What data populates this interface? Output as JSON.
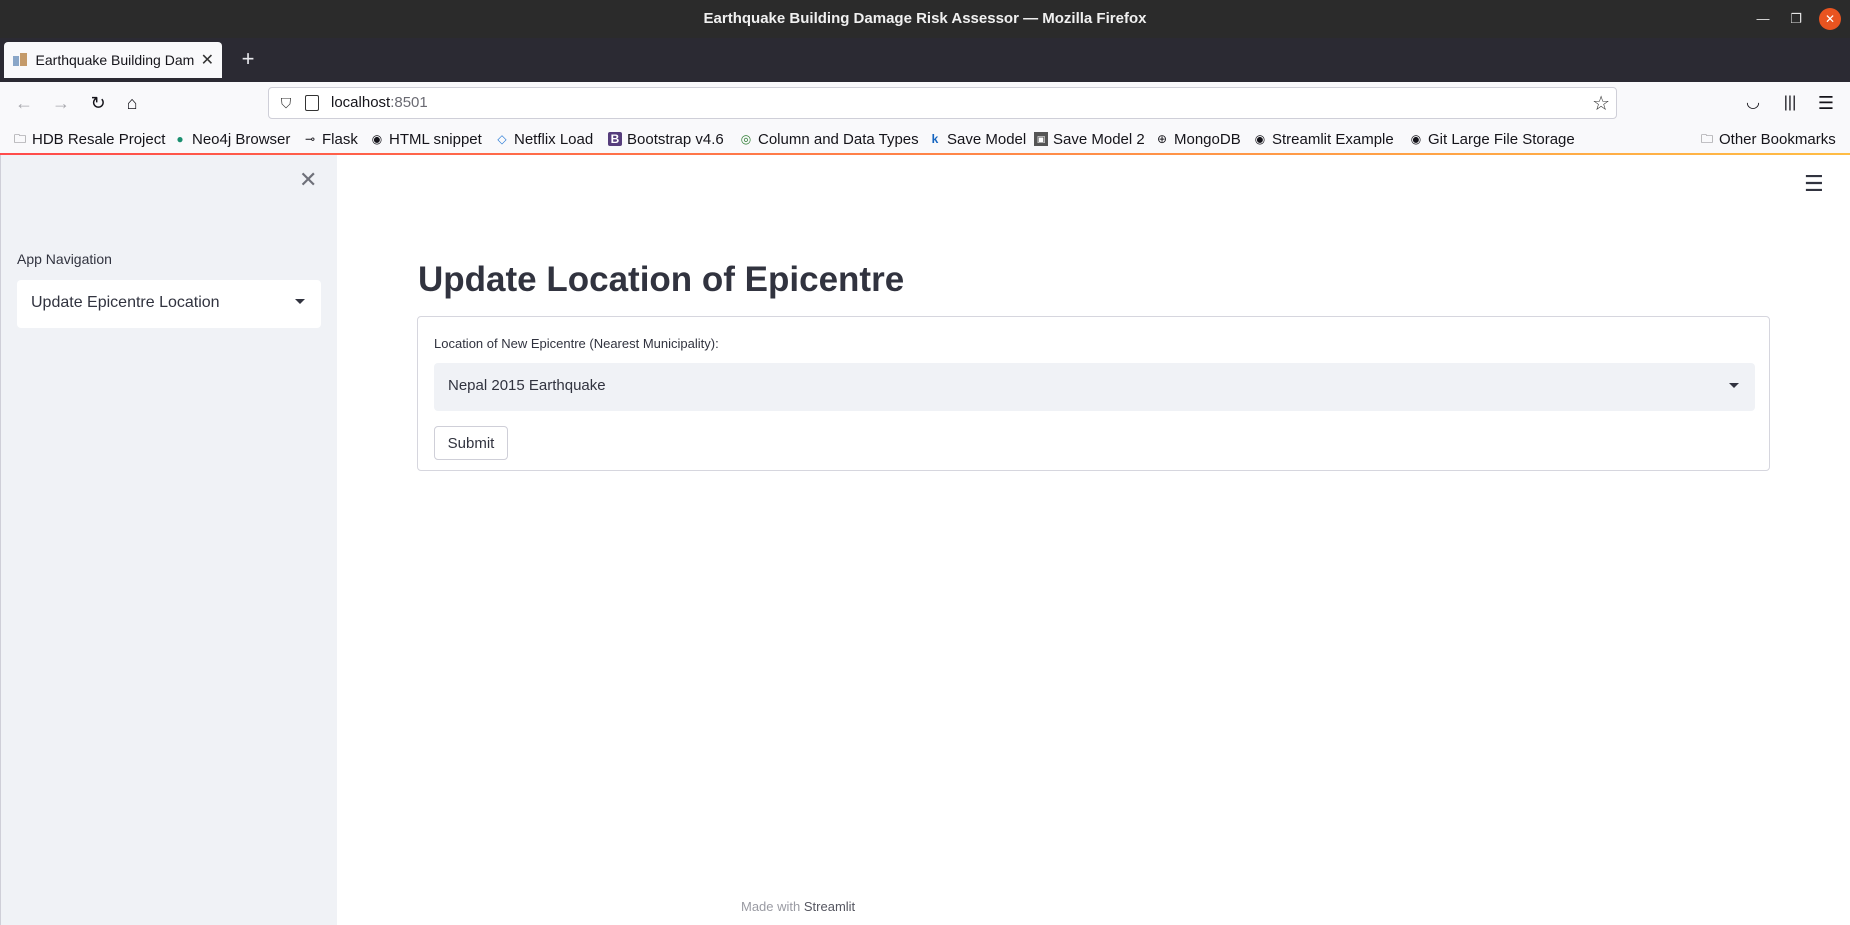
{
  "window": {
    "title": "Earthquake Building Damage Risk Assessor — Mozilla Firefox"
  },
  "tabs": [
    {
      "label": "Earthquake Building Dam"
    }
  ],
  "urlbar": {
    "host": "localhost",
    "port": ":8501"
  },
  "bookmarks": [
    {
      "label": "HDB Resale Project",
      "icon": "folder-icon"
    },
    {
      "label": "Neo4j Browser",
      "icon": "neo4j-icon"
    },
    {
      "label": "Flask",
      "icon": "flask-icon"
    },
    {
      "label": "HTML snippet",
      "icon": "github-icon"
    },
    {
      "label": "Netflix Load",
      "icon": "code-icon"
    },
    {
      "label": "Bootstrap v4.6",
      "icon": "bootstrap-icon"
    },
    {
      "label": "Column and Data Types",
      "icon": "target-icon"
    },
    {
      "label": "Save Model",
      "icon": "k-icon"
    },
    {
      "label": "Save Model 2",
      "icon": "image-icon"
    },
    {
      "label": "MongoDB",
      "icon": "globe-icon"
    },
    {
      "label": "Streamlit Example",
      "icon": "github-icon"
    },
    {
      "label": "Git Large File Storage",
      "icon": "github-icon"
    }
  ],
  "other_bookmarks": {
    "label": "Other Bookmarks"
  },
  "sidebar": {
    "nav_label": "App Navigation",
    "nav_selected": "Update Epicentre Location"
  },
  "main": {
    "title": "Update Location of Epicentre",
    "form": {
      "field_label": "Location of New Epicentre (Nearest Municipality):",
      "field_value": "Nepal 2015 Earthquake",
      "submit_label": "Submit"
    },
    "footer": {
      "prefix": "Made with",
      "brand": "Streamlit"
    }
  },
  "colors": {
    "sidebar_bg": "#f0f2f6",
    "text": "#31333f",
    "accent": "#ff4b4b",
    "titlebar_bg": "#2b2b2b",
    "close_button": "#e95420"
  }
}
